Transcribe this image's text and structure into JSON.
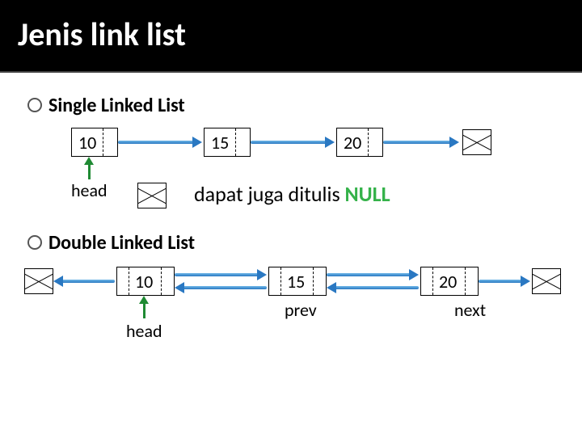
{
  "title": "Jenis link list",
  "sections": {
    "single": {
      "heading": "Single Linked List"
    },
    "double": {
      "heading": "Double Linked List"
    }
  },
  "singly": {
    "nodes": [
      "10",
      "15",
      "20"
    ],
    "head_label": "head",
    "note_prefix": "dapat juga ditulis ",
    "note_null": "NULL"
  },
  "doubly": {
    "nodes": [
      "10",
      "15",
      "20"
    ],
    "head_label": "head",
    "prev_label": "prev",
    "next_label": "next"
  }
}
